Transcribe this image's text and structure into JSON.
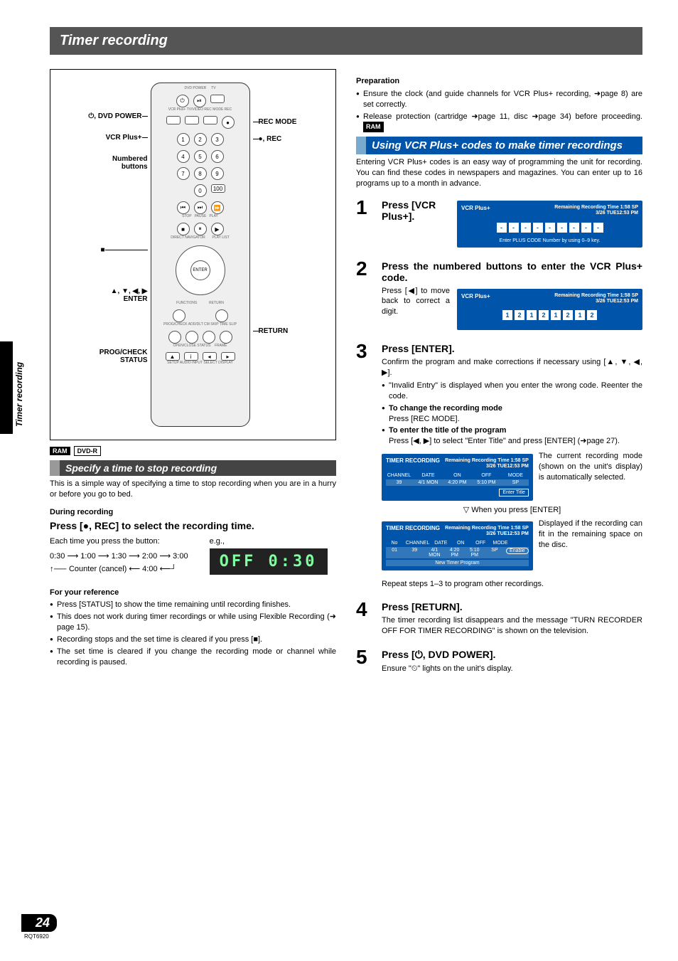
{
  "sideLabel": "Timer recording",
  "title": "Timer recording",
  "pageNumber": "24",
  "docCode": "RQT6920",
  "left": {
    "callouts": {
      "dvdPower": "⏻, DVD POWER",
      "vcrPlus": "VCR Plus+",
      "numbered": "Numbered buttons",
      "stop": "■",
      "arrows": "▲, ▼, ◀, ▶ ENTER",
      "progCheck": "PROG/CHECK STATUS",
      "recMode": "REC MODE",
      "rec": "●, REC",
      "return": "RETURN"
    },
    "badges": {
      "ram": "RAM",
      "dvdr": "DVD-R"
    },
    "specify": {
      "heading": "Specify a time to stop recording",
      "intro": "This is a simple way of specifying a time to stop recording when you are in a hurry or before you go to bed.",
      "during": "During recording",
      "press": "Press [●, REC] to select the recording time.",
      "eachTime": "Each time you press the button:",
      "eg": "e.g.,",
      "flow1": "0:30 ⟶ 1:00 ⟶ 1:30 ⟶ 2:00 ⟶ 3:00",
      "flow2": "↑⸺ Counter (cancel) ⟵ 4:00 ⟵┘",
      "lcd": "OFF  0:30",
      "refHead": "For your reference",
      "refs": [
        "Press [STATUS] to show the time remaining until recording finishes.",
        "This does not work during timer recordings or while using Flexible Recording (➜ page 15).",
        "Recording stops and the set time is cleared if you press [■].",
        "The set time is cleared if you change the recording mode or channel while recording is paused."
      ]
    }
  },
  "right": {
    "prep": {
      "heading": "Preparation",
      "items": [
        "Ensure the clock (and guide channels for VCR Plus+ recording, ➜page 8) are set correctly.",
        "Release protection (cartridge ➜page 11, disc ➜page 34) before proceeding."
      ],
      "ramBadge": "RAM"
    },
    "blueHeading": "Using VCR Plus+ codes to make timer recordings",
    "blueIntro": "Entering VCR Plus+ codes is an easy way of programming the unit for recording. You can find these codes in newspapers and magazines. You can enter up to 16 programs up to a month in advance.",
    "osdCommon": {
      "vcrPlusLabel": "VCR Plus+",
      "remLabel": "Remaining Recording Time",
      "remVal": "1:58 SP",
      "dateTime": "3/26 TUE12:53 PM",
      "timerRec": "TIMER RECORDING"
    },
    "step1": {
      "head": "Press [VCR Plus+].",
      "hint": "Enter PLUS CODE Number by using 0–9 key.",
      "dashes": [
        "-",
        "-",
        "-",
        "-",
        "-",
        "-",
        "-",
        "-",
        "-"
      ]
    },
    "step2": {
      "head": "Press the numbered buttons to enter the VCR Plus+ code.",
      "note": "Press [◀] to move back to correct a digit.",
      "digits": [
        "1",
        "2",
        "1",
        "2",
        "1",
        "2",
        "1",
        "2"
      ]
    },
    "step3": {
      "head": "Press [ENTER].",
      "confirm": "Confirm the program and make corrections if necessary using [▲, ▼, ◀, ▶].",
      "invalid": "\"Invalid Entry\" is displayed when you enter the wrong code. Reenter the code.",
      "changeMode": "To change the recording mode",
      "changeModeBody": "Press [REC MODE].",
      "enterTitle": "To enter the title of the program",
      "enterTitleBody": "Press [◀, ▶] to select \"Enter Title\" and press [ENTER] (➜page 27).",
      "osdA": {
        "cols": [
          "CHANNEL",
          "DATE",
          "ON",
          "OFF",
          "MODE"
        ],
        "row": [
          "39",
          "4/1 MON",
          "4:20 PM",
          "5:10 PM",
          "SP"
        ],
        "enterTitleBtn": "Enter Title"
      },
      "noteA": "The current recording mode (shown on the unit's display) is automatically selected.",
      "tri": "When you press [ENTER]",
      "osdB": {
        "cols": [
          "No",
          "CHANNEL",
          "DATE",
          "ON",
          "OFF",
          "MODE",
          ""
        ],
        "row": [
          "01",
          "39",
          "4/1 MON",
          "4:20 PM",
          "5:10 PM",
          "SP",
          "Enable"
        ],
        "newProg": "New Timer Program"
      },
      "noteB": "Displayed if the recording can fit in the remaining space on the disc.",
      "repeat": "Repeat steps 1–3 to program other recordings."
    },
    "step4": {
      "head": "Press [RETURN].",
      "body": "The timer recording list disappears and the message \"TURN RECORDER OFF FOR TIMER RECORDING\" is shown on the television."
    },
    "step5": {
      "head": "Press [⏻, DVD POWER].",
      "body": "Ensure \"⏲\" lights on the unit's display."
    }
  }
}
